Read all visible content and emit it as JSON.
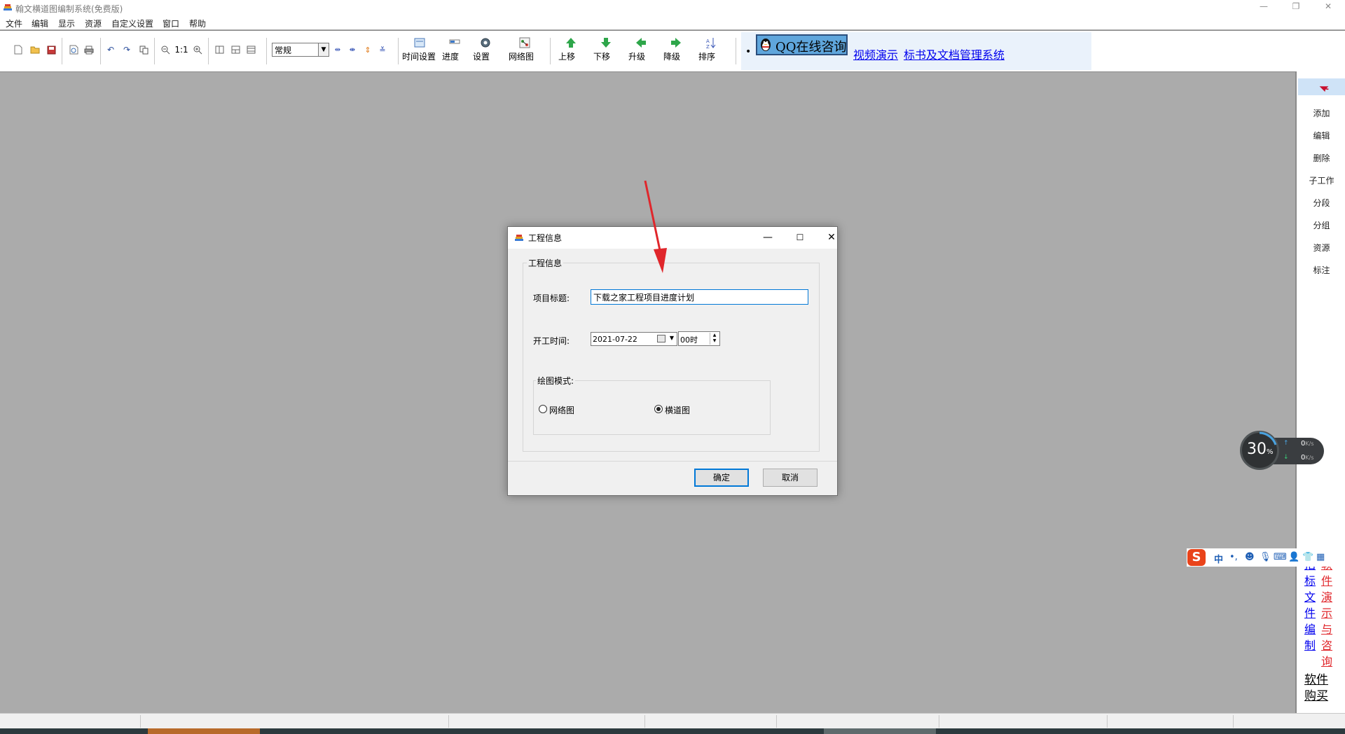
{
  "app": {
    "title": "翰文横道图编制系统(免费版)"
  },
  "menu": [
    "文件",
    "编辑",
    "显示",
    "资源",
    "自定义设置",
    "窗口",
    "帮助"
  ],
  "toolbar": {
    "mode_select": "常规",
    "zoom_label": "1:1",
    "buttons": [
      {
        "label": "时间设置",
        "icon": "time-settings-icon"
      },
      {
        "label": "进度",
        "icon": "progress-icon"
      },
      {
        "label": "设置",
        "icon": "settings-icon"
      },
      {
        "label": "网络图",
        "icon": "network-diagram-icon"
      },
      {
        "label": "上移",
        "icon": "arrow-up-icon"
      },
      {
        "label": "下移",
        "icon": "arrow-down-icon"
      },
      {
        "label": "升级",
        "icon": "arrow-left-icon"
      },
      {
        "label": "降级",
        "icon": "arrow-right-icon"
      },
      {
        "label": "排序",
        "icon": "sort-icon"
      }
    ],
    "bullet": "•",
    "qq_button": "QQ在线咨询",
    "link_video": "视频演示",
    "link_docs": "标书及文档管理系统"
  },
  "right_panel": {
    "items": [
      "添加",
      "编辑",
      "删除",
      "子工作",
      "分段",
      "分组",
      "资源",
      "标注"
    ],
    "link_blue": "招标文件编制",
    "link_red": "软件演示与咨询",
    "buy": "软件购买"
  },
  "network_widget": {
    "percent": "30",
    "percent_unit": "%",
    "up": "0",
    "down": "0",
    "unit": "K/s"
  },
  "ime": {
    "lang": "中",
    "punct": "•,"
  },
  "dialog": {
    "title": "工程信息",
    "group_title": "工程信息",
    "project_title_label": "项目标题:",
    "project_title_value": "下载之家工程项目进度计划",
    "start_time_label": "开工时间:",
    "start_date": "2021-07-22",
    "start_hour": "00时",
    "draw_mode_label": "绘图模式:",
    "mode_network": "网络图",
    "mode_gantt": "横道图",
    "selected_mode": "横道图",
    "ok": "确定",
    "cancel": "取消"
  },
  "colors": {
    "workspace": "#ababab",
    "selection": "#cfe3f7",
    "accent": "#0078d7",
    "arrow_annotation": "#e0262b"
  }
}
